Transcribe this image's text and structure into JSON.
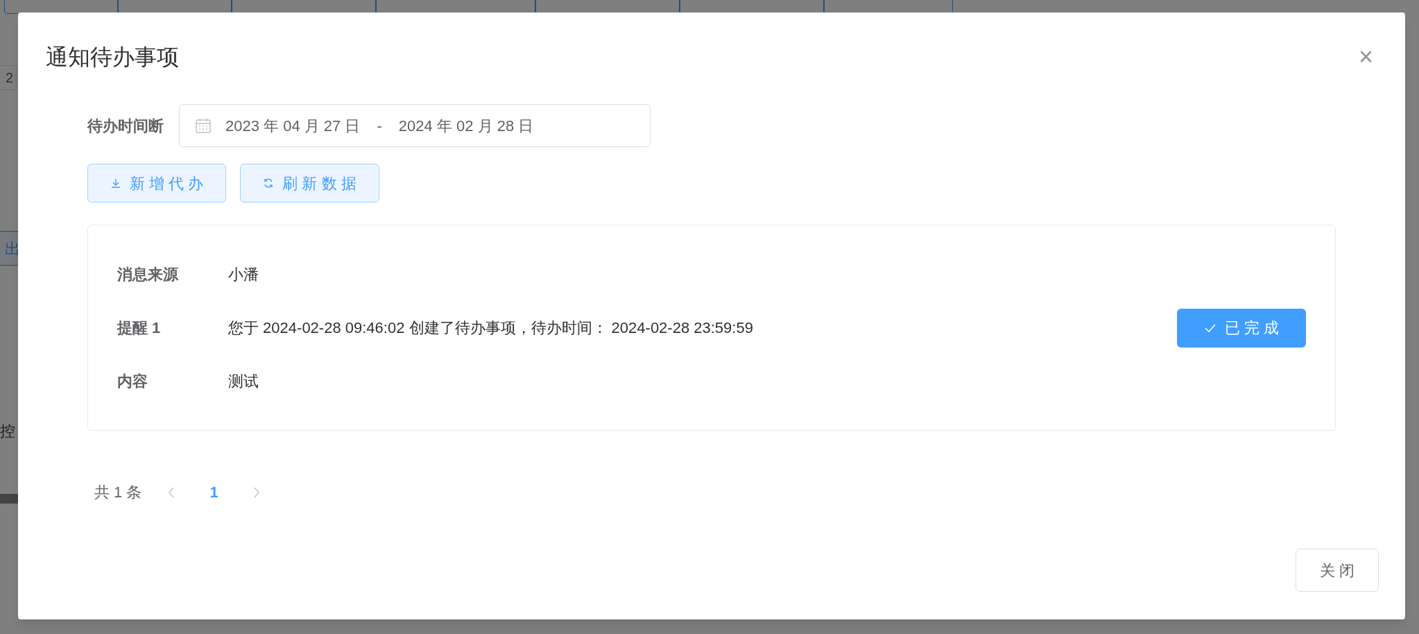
{
  "background": {
    "field_fragment": "2",
    "button_fragment": "出",
    "text_fragment": "控"
  },
  "dialog": {
    "title": "通知待办事项",
    "close_icon": "×",
    "date_range": {
      "label": "待办时间断",
      "start": "2023 年 04 月 27 日",
      "separator": "-",
      "end": "2024 年 02 月 28 日"
    },
    "buttons": [
      {
        "kind": "download",
        "label": "新 增 代 办"
      },
      {
        "kind": "refresh",
        "label": "刷 新 数 据"
      }
    ],
    "items": [
      {
        "rows": [
          {
            "label": "消息来源",
            "value": "小潘"
          },
          {
            "label": "提醒 1",
            "value": "您于 2024-02-28 09:46:02 创建了待办事项，待办时间： 2024-02-28 23:59:59"
          },
          {
            "label": "内容",
            "value": "测试"
          }
        ],
        "done": true,
        "done_label": "已 完 成"
      }
    ],
    "pagination": {
      "total": "共 1 条",
      "pages": [
        {
          "label": "1",
          "selected": true
        }
      ]
    },
    "footer_button": "关 闭"
  }
}
